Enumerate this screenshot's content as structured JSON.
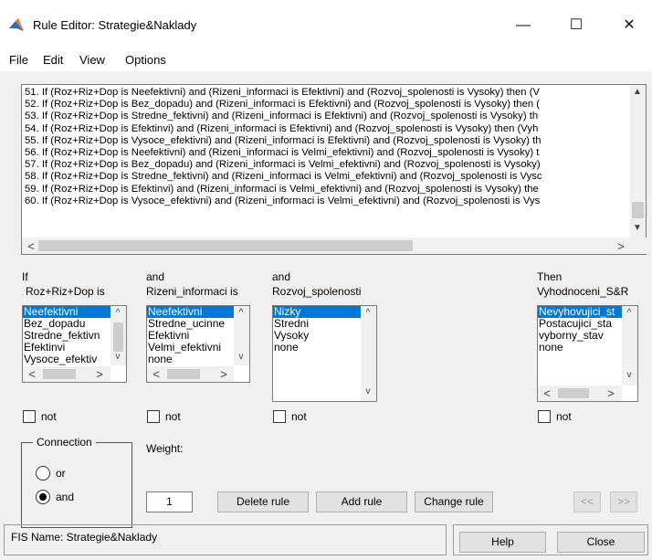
{
  "window": {
    "title": "Rule Editor: Strategie&Naklady",
    "min": "—",
    "max": "☐",
    "close": "✕"
  },
  "menu": [
    "File",
    "Edit",
    "View",
    "Options"
  ],
  "rules": [
    "51. If (Roz+Riz+Dop is Neefektivni) and (Rizeni_informaci is Efektivni) and (Rozvoj_spolenosti is Vysoky) then (V",
    "52. If (Roz+Riz+Dop is Bez_dopadu) and (Rizeni_informaci is Efektivni) and (Rozvoj_spolenosti is Vysoky) then (",
    "53. If (Roz+Riz+Dop is Stredne_fektivni) and (Rizeni_informaci is Efektivni) and (Rozvoj_spolenosti is Vysoky) th",
    "54. If (Roz+Riz+Dop is Efektinvi) and (Rizeni_informaci is Efektivni) and (Rozvoj_spolenosti is Vysoky) then (Vyh",
    "55. If (Roz+Riz+Dop is Vysoce_efektivni) and (Rizeni_informaci is Efektivni) and (Rozvoj_spolenosti is Vysoky) th",
    "56. If (Roz+Riz+Dop is Neefektivni) and (Rizeni_informaci is Velmi_efektivni) and (Rozvoj_spolenosti is Vysoky) t",
    "57. If (Roz+Riz+Dop is Bez_dopadu) and (Rizeni_informaci is Velmi_efektivni) and (Rozvoj_spolenosti is Vysoky)",
    "58. If (Roz+Riz+Dop is Stredne_fektivni) and (Rizeni_informaci is Velmi_efektivni) and (Rozvoj_spolenosti is Vysc",
    "59. If (Roz+Riz+Dop is Efektinvi) and (Rizeni_informaci is Velmi_efektivni) and (Rozvoj_spolenosti is Vysoky) the",
    "60. If (Roz+Riz+Dop is Vysoce_efektivni) and (Rizeni_informaci is Velmi_efektivni) and (Rozvoj_spolenosti is Vys"
  ],
  "inputs": [
    {
      "prefix": "If",
      "name": "Roz+Riz+Dop is",
      "items": [
        "Neefektivni",
        "Bez_dopadu",
        "Stredne_fektivn",
        "Efektinvi",
        "Vysoce_efektiv"
      ],
      "selected": 0,
      "not": "not"
    },
    {
      "prefix": "and",
      "name": "Rizeni_informaci is",
      "items": [
        "Neefektivni",
        "Stredne_ucinne",
        "Efektivni",
        "Velmi_efektivni",
        "none"
      ],
      "selected": 0,
      "not": "not"
    },
    {
      "prefix": "and",
      "name": "Rozvoj_spolenosti",
      "items": [
        "Nizky",
        "Stredni",
        "Vysoky",
        "none"
      ],
      "selected": 0,
      "not": "not"
    }
  ],
  "output": {
    "prefix": "Then",
    "name": "Vyhodnoceni_S&R",
    "items": [
      "Nevyhovujici_st",
      "Postacujici_sta",
      "vyborny_stav",
      "none"
    ],
    "selected": 0,
    "not": "not"
  },
  "connection": {
    "title": "Connection",
    "options": [
      "or",
      "and"
    ],
    "selected": "and"
  },
  "weight": {
    "label": "Weight:",
    "value": "1"
  },
  "buttons": {
    "delete": "Delete rule",
    "add": "Add rule",
    "change": "Change rule",
    "prev": "<<",
    "next": ">>"
  },
  "status": {
    "fis_name": "FIS Name: Strategie&Naklady",
    "help": "Help",
    "close": "Close"
  },
  "colors": {
    "selection": "#0078d7",
    "background": "#f0f0f0"
  }
}
